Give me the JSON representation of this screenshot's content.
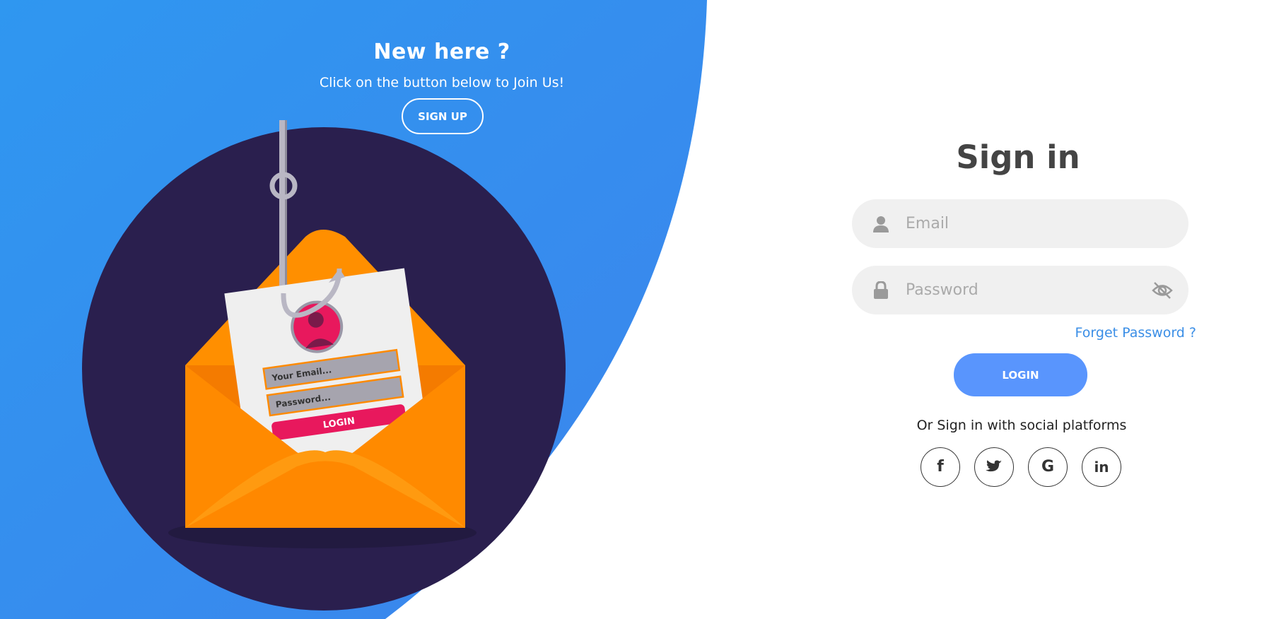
{
  "left_panel": {
    "title": "New here ?",
    "text": "Click on the button below to Join Us!",
    "signup_label": "SIGN UP",
    "illustration": {
      "email_placeholder": "Your Email...",
      "password_placeholder": "Password...",
      "login_label": "LOGIN"
    }
  },
  "signin": {
    "title": "Sign in",
    "email_placeholder": "Email",
    "password_placeholder": "Password",
    "forgot_label": "Forget Password ?",
    "login_label": "LOGIN",
    "social_text": "Or Sign in with social platforms",
    "social": [
      {
        "name": "facebook-icon",
        "glyph": "f"
      },
      {
        "name": "twitter-icon",
        "glyph": ""
      },
      {
        "name": "google-icon",
        "glyph": "G"
      },
      {
        "name": "linkedin-icon",
        "glyph": "in"
      }
    ]
  },
  "colors": {
    "primary_blue": "#5995fd",
    "panel_blue": "#3390ee",
    "circle_navy": "#2a1f4e",
    "envelope_orange": "#ff8a00",
    "accent_pink": "#e8185d",
    "input_bg": "#f0f0f0",
    "link_blue": "#3a8ee6"
  }
}
